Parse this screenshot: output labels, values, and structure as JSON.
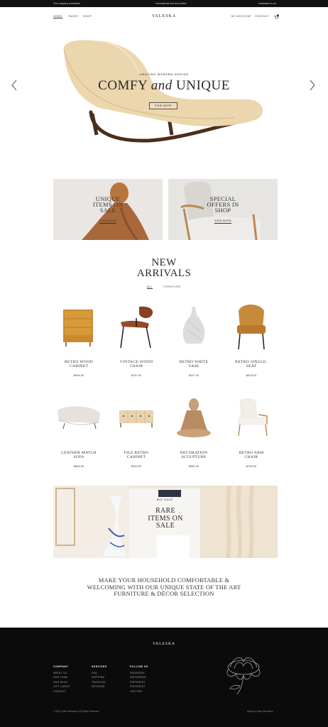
{
  "topbar": {
    "left": "Free shipping worldwide",
    "center": "International deli and collect",
    "right": "dedicated to our"
  },
  "nav": {
    "home": "Home",
    "pages": "Pages",
    "shop": "Shop",
    "logo": "VALESKA",
    "my_account": "My Account",
    "contact": "Contact",
    "cart_count": "0"
  },
  "hero": {
    "kicker": "AMAZING MODERN DESIGN",
    "title_a": "COMFY",
    "title_and": "and",
    "title_b": "UNIQUE",
    "button": "VIEW MORE"
  },
  "promos": [
    {
      "line1": "UNIQUE",
      "line2": "ITEMS ON",
      "line3": "SALE",
      "link": "VIEW MORE"
    },
    {
      "line1": "SPECIAL",
      "line2": "OFFERS IN",
      "line3": "SHOP",
      "link": "VIEW MORE"
    }
  ],
  "arrivals": {
    "title_1": "NEW",
    "title_2": "ARRIVALS",
    "filter_all": "ALL",
    "filter_furniture": "FURNITURE"
  },
  "products": [
    {
      "l1": "RETRO WOOD",
      "l2": "CABINET",
      "price": "$996.00"
    },
    {
      "l1": "VINTAGE WOOD",
      "l2": "CHAIR",
      "price": "$787.00"
    },
    {
      "l1": "RETRO WHITE",
      "l2": "VASE",
      "price": "$267.00"
    },
    {
      "l1": "RETRO SINGLE-",
      "l2": "SEAT",
      "price": "$878.00"
    },
    {
      "l1": "LEATHER MATCH",
      "l2": "SOFA",
      "price": "$806.00"
    },
    {
      "l1": "FILE RETRO",
      "l2": "CABINET",
      "price": "$545.00"
    },
    {
      "l1": "DECORATION",
      "l2": "SCULPTURE",
      "price": "$980.00"
    },
    {
      "l1": "RETRO ARM",
      "l2": "CHAIR",
      "price": "$799.00"
    }
  ],
  "banner": {
    "kicker": "BIG SALE",
    "line1": "RARE",
    "line2": "ITEMS ON",
    "line3": "SALE"
  },
  "tagline": {
    "line1": "MAKE YOUR HOUSEHOLD COMFORTABLE &",
    "line2": "WELCOMING WITH OUR UNIQUE STATE OF THE ART",
    "line3": "FURNITURE & DÉCOR SELECTION"
  },
  "footer": {
    "logo": "VALESKA",
    "company": {
      "heading": "COMPANY",
      "items": [
        "About us",
        "Our team",
        "Our blog",
        "Gift cards",
        "Contact"
      ]
    },
    "services": {
      "heading": "SERVICES",
      "items": [
        "FAQ",
        "Shipping",
        "Tracking",
        "Returns"
      ]
    },
    "follow": {
      "heading": "FOLLOW US",
      "items": [
        "Facebook",
        "Instagram",
        "Pinterest",
        "Pinterest",
        "Twitter"
      ]
    },
    "copyright": "© 2021 Qode Interactive, All Rights Reserved",
    "made_by": "Made by Qode Interactive"
  },
  "colors": {
    "footer_bg": "#0b0b0b",
    "topbar_bg": "#111111",
    "text": "#2a2a2a"
  }
}
